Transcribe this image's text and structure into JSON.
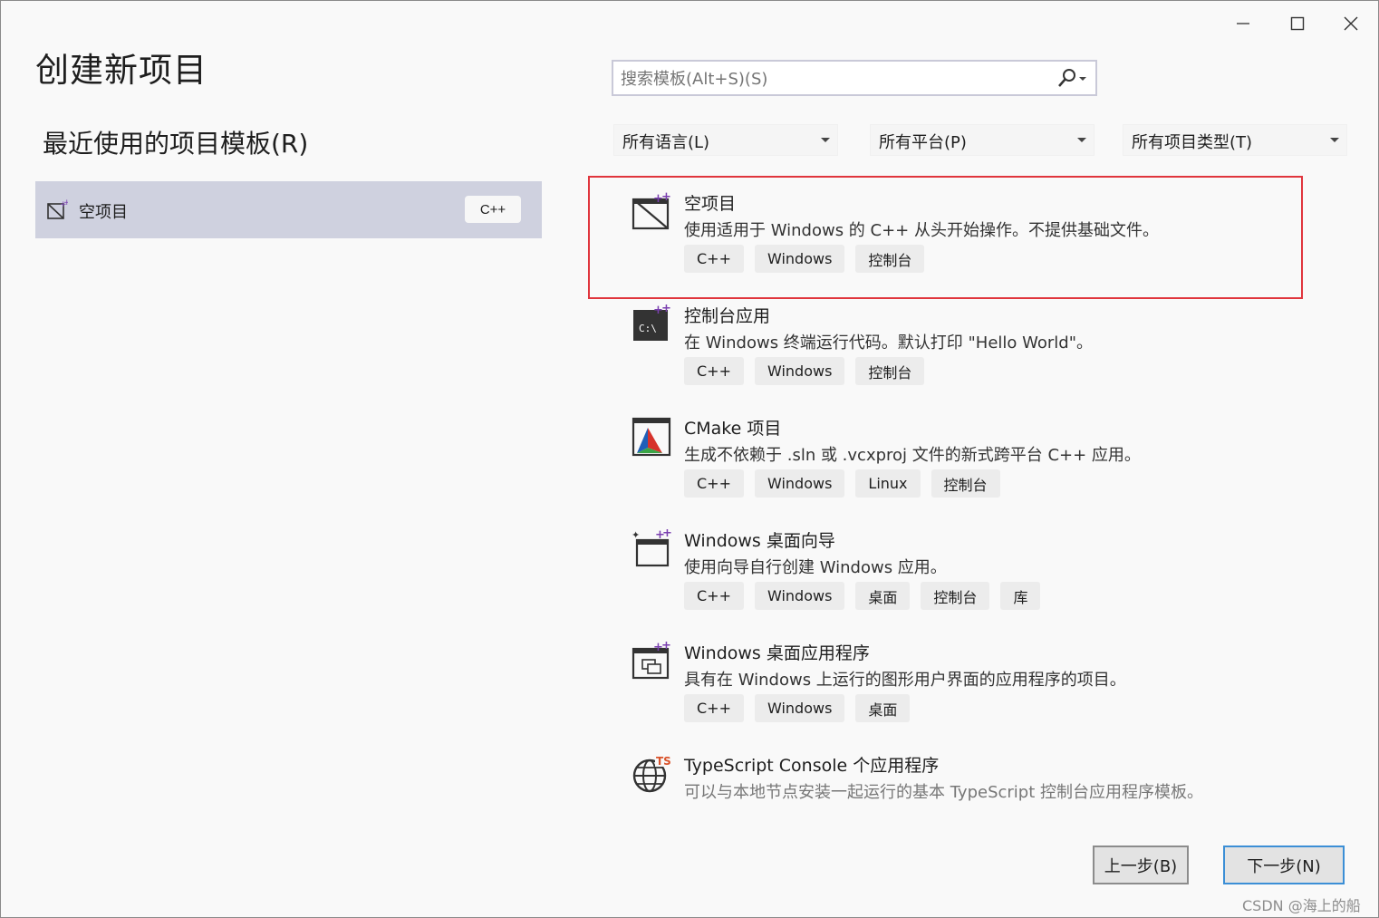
{
  "window": {
    "title": "创建新项目",
    "minimize": "minimize",
    "maximize": "maximize",
    "close": "close"
  },
  "recent": {
    "heading": "最近使用的项目模板(R)",
    "items": [
      {
        "label": "空项目",
        "tag": "C++",
        "icon": "empty-project-icon"
      }
    ]
  },
  "search": {
    "placeholder": "搜索模板(Alt+S)(S)",
    "icon": "search-icon"
  },
  "filters": [
    {
      "label": "所有语言(L)"
    },
    {
      "label": "所有平台(P)"
    },
    {
      "label": "所有项目类型(T)"
    }
  ],
  "templates": [
    {
      "name": "空项目",
      "desc": "使用适用于 Windows 的 C++ 从头开始操作。不提供基础文件。",
      "tags": [
        "C++",
        "Windows",
        "控制台"
      ],
      "icon": "empty-project-icon",
      "selected": true
    },
    {
      "name": "控制台应用",
      "desc": "在 Windows 终端运行代码。默认打印 \"Hello World\"。",
      "tags": [
        "C++",
        "Windows",
        "控制台"
      ],
      "icon": "console-app-icon"
    },
    {
      "name": "CMake 项目",
      "desc": "生成不依赖于 .sln 或 .vcxproj 文件的新式跨平台 C++ 应用。",
      "tags": [
        "C++",
        "Windows",
        "Linux",
        "控制台"
      ],
      "icon": "cmake-icon"
    },
    {
      "name": "Windows 桌面向导",
      "desc": "使用向导自行创建 Windows 应用。",
      "tags": [
        "C++",
        "Windows",
        "桌面",
        "控制台",
        "库"
      ],
      "icon": "wizard-icon"
    },
    {
      "name": "Windows 桌面应用程序",
      "desc": "具有在 Windows 上运行的图形用户界面的应用程序的项目。",
      "tags": [
        "C++",
        "Windows",
        "桌面"
      ],
      "icon": "desktop-app-icon"
    },
    {
      "name": "TypeScript Console 个应用程序",
      "desc": "可以与本地节点安装一起运行的基本 TypeScript 控制台应用程序模板。",
      "tags": [],
      "icon": "typescript-globe-icon"
    }
  ],
  "buttons": {
    "back": "上一步(B)",
    "next": "下一步(N)"
  },
  "watermark": "CSDN @海上的船",
  "colors": {
    "highlight": "#e0353d",
    "selected_bg": "#cfd1df",
    "primary_border": "#3c8fd6"
  }
}
